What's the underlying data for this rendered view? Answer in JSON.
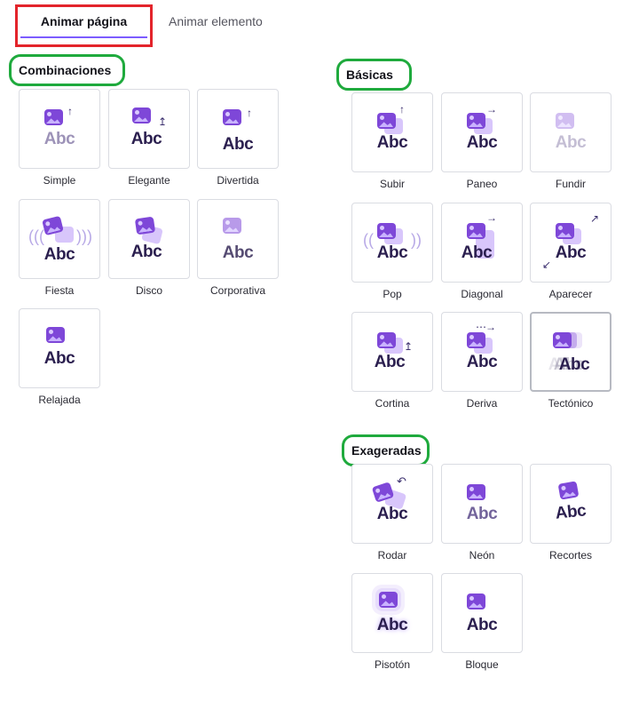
{
  "tabs": {
    "active_label": "Animar página",
    "inactive_label": "Animar elemento"
  },
  "sections": {
    "combinaciones": {
      "title": "Combinaciones",
      "items": [
        "Simple",
        "Elegante",
        "Divertida",
        "Fiesta",
        "Disco",
        "Corporativa",
        "Relajada"
      ]
    },
    "basicas": {
      "title": "Básicas",
      "items": [
        "Subir",
        "Paneo",
        "Fundir",
        "Pop",
        "Diagonal",
        "Aparecer",
        "Cortina",
        "Deriva",
        "Tectónico"
      ]
    },
    "exageradas": {
      "title": "Exageradas",
      "items": [
        "Rodar",
        "Neón",
        "Recortes",
        "Pisotón",
        "Bloque"
      ]
    }
  },
  "preview_text": "Abc",
  "colors": {
    "tab_highlight": "#e3242b",
    "section_outline": "#1faa3d",
    "accent": "#7e47d8",
    "tab_underline": "#7c5cff"
  }
}
